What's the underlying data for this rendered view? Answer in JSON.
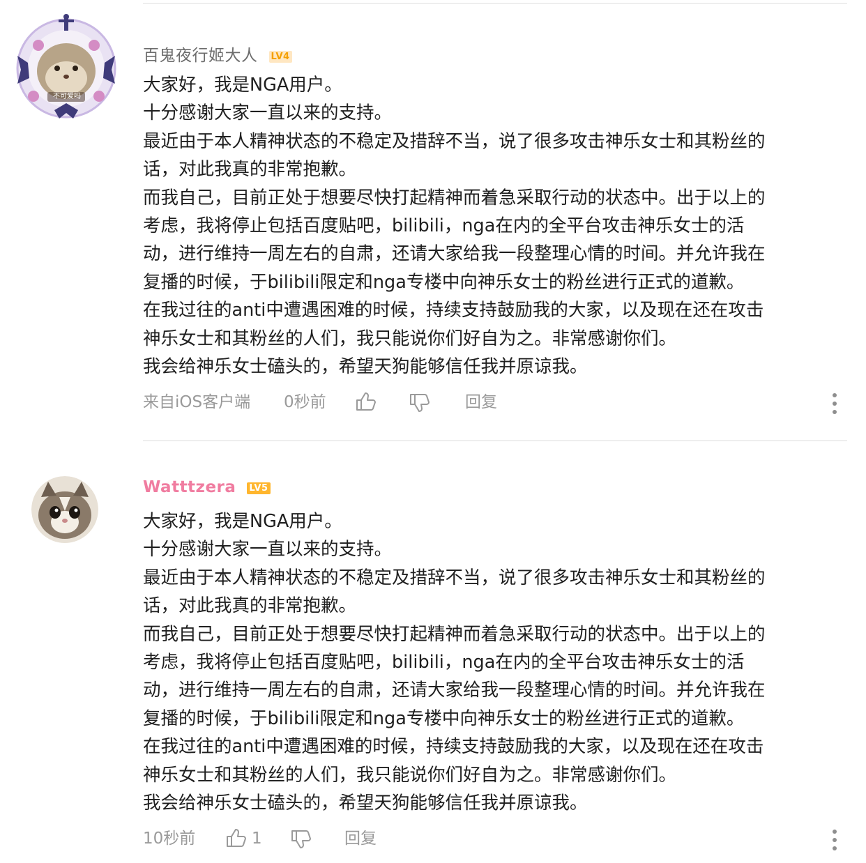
{
  "comments": [
    {
      "username": "百鬼夜行姬大人",
      "level": "LV4",
      "avatar_badge": "不可爱吗",
      "lines": [
        "大家好，我是NGA用户。",
        "十分感谢大家一直以来的支持。",
        "最近由于本人精神状态的不稳定及措辞不当，说了很多攻击神乐女士和其粉丝的",
        "话，对此我真的非常抱歉。",
        "而我自己，目前正处于想要尽快打起精神而着急采取行动的状态中。出于以上的",
        "考虑，我将停止包括百度贴吧，bilibili，nga在内的全平台攻击神乐女士的活",
        "动，进行维持一周左右的自肃，还请大家给我一段整理心情的时间。并允许我在",
        "复播的时候，于bilibili限定和nga专楼中向神乐女士的粉丝进行正式的道歉。",
        "在我过往的anti中遭遇困难的时候，持续支持鼓励我的大家，以及现在还在攻击",
        "神乐女士和其粉丝的人们，我只能说你们好自为之。非常感谢你们。",
        "我会给神乐女士磕头的，希望天狗能够信任我并原谅我。"
      ],
      "source": "来自iOS客户端",
      "time": "0秒前",
      "like_count": "",
      "reply_label": "回复"
    },
    {
      "username": "Watttzera",
      "level": "LV5",
      "lines": [
        "大家好，我是NGA用户。",
        "十分感谢大家一直以来的支持。",
        "最近由于本人精神状态的不稳定及措辞不当，说了很多攻击神乐女士和其粉丝的",
        "话，对此我真的非常抱歉。",
        "而我自己，目前正处于想要尽快打起精神而着急采取行动的状态中。出于以上的",
        "考虑，我将停止包括百度贴吧，bilibili，nga在内的全平台攻击神乐女士的活",
        "动，进行维持一周左右的自肃，还请大家给我一段整理心情的时间。并允许我在",
        "复播的时候，于bilibili限定和nga专楼中向神乐女士的粉丝进行正式的道歉。",
        "在我过往的anti中遭遇困难的时候，持续支持鼓励我的大家，以及现在还在攻击",
        "神乐女士和其粉丝的人们，我只能说你们好自为之。非常感谢你们。",
        "我会给神乐女士磕头的，希望天狗能够信任我并原谅我。"
      ],
      "time": "10秒前",
      "like_count": "1",
      "reply_label": "回复"
    }
  ],
  "colors": {
    "username_default": "#6d6d6d",
    "username_vip": "#f07ca0",
    "level_lv4_bg": "#ffe7c2",
    "level_lv4_fg": "#f5a000",
    "level_lv5_bg": "#ffb62e",
    "level_lv5_fg": "#ffffff",
    "meta": "#9a9a9a"
  }
}
